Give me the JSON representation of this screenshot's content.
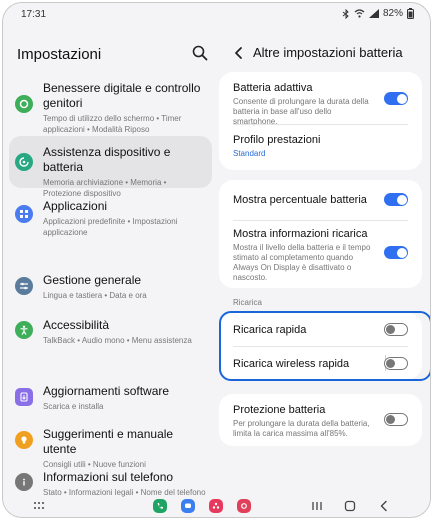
{
  "status_bar": {
    "time": "17:31",
    "battery": "82%"
  },
  "left_panel": {
    "title": "Impostazioni",
    "items": [
      {
        "title": "Benessere digitale e controllo genitori",
        "subtitle": "Tempo di utilizzo dello schermo • Timer applicazioni • Modalità Riposo",
        "icon": "wellbeing-icon",
        "color": "#3fae5a"
      },
      {
        "title": "Assistenza dispositivo e batteria",
        "subtitle": "Memoria archiviazione • Memoria • Protezione dispositivo",
        "icon": "device-care-icon",
        "color": "#27a882"
      },
      {
        "title": "Applicazioni",
        "subtitle": "Applicazioni predefinite • Impostazioni applicazione",
        "icon": "apps-icon",
        "color": "#4a7cf0"
      },
      {
        "title": "Gestione generale",
        "subtitle": "Lingua e tastiera • Data e ora",
        "icon": "sliders-icon",
        "color": "#5a7b9c"
      },
      {
        "title": "Accessibilità",
        "subtitle": "TalkBack • Audio mono • Menu assistenza",
        "icon": "accessibility-icon",
        "color": "#3fae5a"
      },
      {
        "title": "Aggiornamenti software",
        "subtitle": "Scarica e installa",
        "icon": "software-update-icon",
        "color": "#8a6ee8"
      },
      {
        "title": "Suggerimenti e manuale utente",
        "subtitle": "Consigli utili • Nuove funzioni",
        "icon": "tips-icon",
        "color": "#f0a020"
      },
      {
        "title": "Informazioni sul telefono",
        "subtitle": "Stato • Informazioni legali • Nome del telefono",
        "icon": "phone-info-icon",
        "color": "#777777"
      }
    ]
  },
  "right_panel": {
    "title": "Altre impostazioni batteria",
    "adaptive": {
      "title": "Batteria adattiva",
      "subtitle": "Consente di prolungare la durata della batteria in base all'uso dello smartphone.",
      "on": true
    },
    "performance": {
      "title": "Profilo prestazioni",
      "value": "Standard"
    },
    "show_percentage": {
      "title": "Mostra percentuale batteria",
      "on": true
    },
    "charging_info": {
      "title": "Mostra informazioni ricarica",
      "subtitle": "Mostra il livello della batteria e il tempo stimato al completamento quando Always On Display è disattivato o nascosto.",
      "on": true
    },
    "charging_section": "Ricarica",
    "fast_charging": {
      "title": "Ricarica rapida",
      "on": false
    },
    "fast_wireless": {
      "title": "Ricarica wireless rapida",
      "on": false
    },
    "protection": {
      "title": "Protezione batteria",
      "subtitle": "Per prolungare la durata della batteria, limita la carica massima all'85%.",
      "on": false
    }
  },
  "nav_bar": {
    "apps": [
      {
        "name": "phone-app-icon",
        "color": "#1fa463"
      },
      {
        "name": "messages-app-icon",
        "color": "#3b7ef0"
      },
      {
        "name": "bixby-app-icon",
        "color": "#e8385d"
      },
      {
        "name": "camera-app-icon",
        "color": "#e0405a"
      }
    ]
  }
}
